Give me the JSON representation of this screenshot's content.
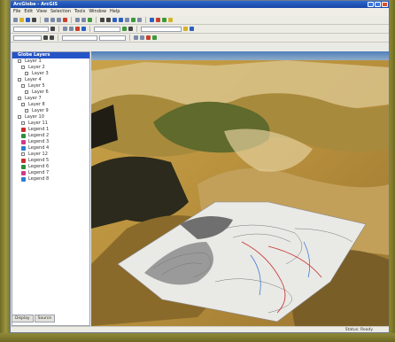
{
  "window": {
    "title": "ArcGlobe - ArcGIS"
  },
  "menubar": {
    "items": [
      "File",
      "Edit",
      "View",
      "Selection",
      "Tools",
      "Window",
      "Help"
    ]
  },
  "toc": {
    "header": "Globe Layers",
    "tabs": [
      "Display",
      "Source"
    ],
    "layers": [
      {
        "label": "Layer 1",
        "indent": 10,
        "swatch": ""
      },
      {
        "label": "Layer 2",
        "indent": 14,
        "swatch": ""
      },
      {
        "label": "Layer 3",
        "indent": 18,
        "swatch": ""
      },
      {
        "label": "Layer 4",
        "indent": 18,
        "swatch": ""
      },
      {
        "label": "Layer 5",
        "indent": 18,
        "swatch": ""
      },
      {
        "label": "Layer 6",
        "indent": 18,
        "swatch": ""
      },
      {
        "label": "Layer 7",
        "indent": 18,
        "swatch": ""
      },
      {
        "label": "Layer 8",
        "indent": 18,
        "swatch": ""
      },
      {
        "label": "Layer 9",
        "indent": 18,
        "swatch": ""
      },
      {
        "label": "Layer 10",
        "indent": 14,
        "swatch": ""
      },
      {
        "label": "Layer 11",
        "indent": 10,
        "swatch": ""
      },
      {
        "label": "Legend 1",
        "indent": 10,
        "swatch": "#c8302a"
      },
      {
        "label": "Legend 2",
        "indent": 10,
        "swatch": "#2d8f3a"
      },
      {
        "label": "Legend 3",
        "indent": 10,
        "swatch": "#d03a8a"
      },
      {
        "label": "Legend 4",
        "indent": 10,
        "swatch": "#2a7fd0"
      },
      {
        "label": "Layer 12",
        "indent": 6,
        "swatch": ""
      },
      {
        "label": "Legend 5",
        "indent": 10,
        "swatch": "#c8302a"
      },
      {
        "label": "Legend 6",
        "indent": 10,
        "swatch": "#2d8f3a"
      },
      {
        "label": "Legend 7",
        "indent": 10,
        "swatch": "#d03a8a"
      },
      {
        "label": "Legend 8",
        "indent": 10,
        "swatch": "#2a7fd0"
      }
    ]
  },
  "statusbar": {
    "text": "Status: Ready"
  },
  "colors": {
    "titlebar": "#1646a8",
    "toc_header": "#2554c7",
    "frame": "#8f8a3a"
  }
}
